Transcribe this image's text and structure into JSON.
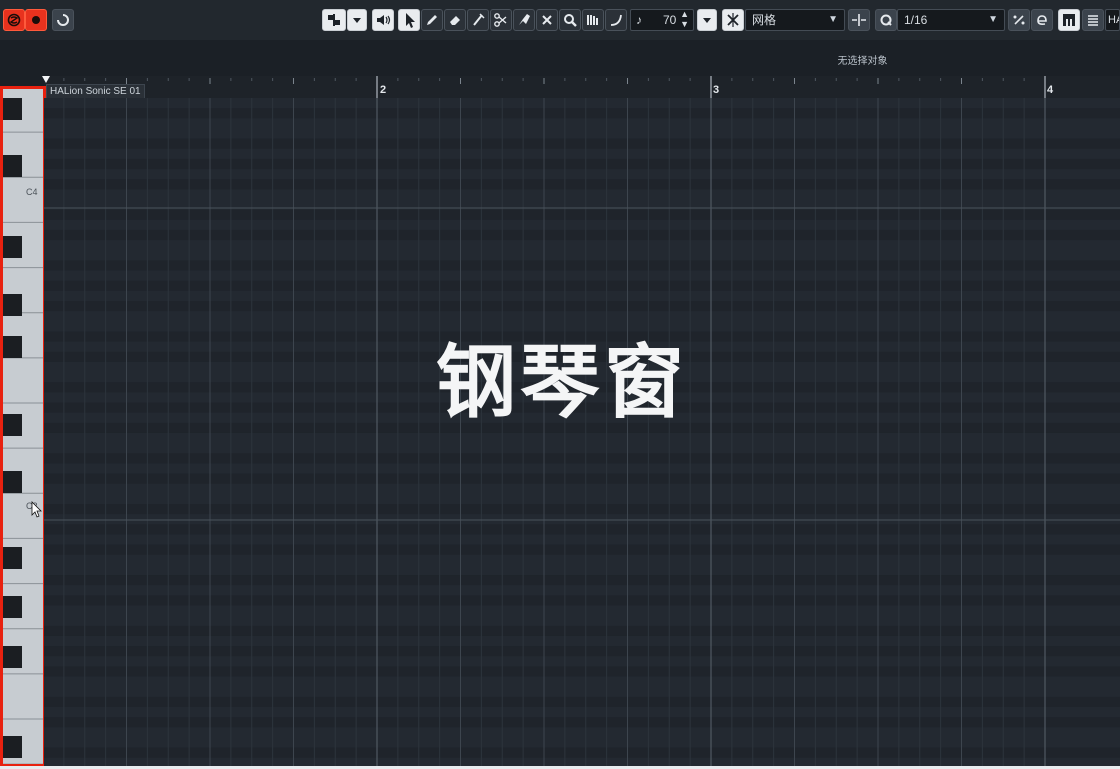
{
  "toolbar": {
    "solo_icon": "solo-monitor-icon",
    "record_icon": "record-icon",
    "cycle_icon": "cycle-icon",
    "velocity_value": "70",
    "grid_type": "网格",
    "quantize_value": "1/16",
    "instrument_short": "HA",
    "colors": {
      "accent_red": "#e8321e",
      "toolbar_bg": "#22282e"
    }
  },
  "status": {
    "selection_text": "无选择对象"
  },
  "ruler": {
    "track_label": "HALion Sonic SE 01",
    "bars": [
      "2",
      "3",
      "4"
    ]
  },
  "keyboard": {
    "labels": [
      "C4",
      "C3"
    ]
  },
  "overlay": {
    "title": "钢琴窗"
  }
}
